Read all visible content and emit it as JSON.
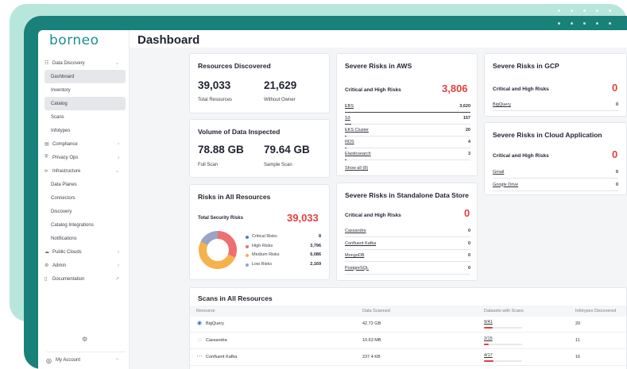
{
  "brand": {
    "logo": "borneo",
    "accent": "#1a8f88"
  },
  "page": {
    "title": "Dashboard"
  },
  "sidebar": {
    "items": [
      {
        "label": "Data Discovery",
        "icon": "grid-icon",
        "chevron": "⌄"
      },
      {
        "label": "Dashboard",
        "sub": true,
        "active": true
      },
      {
        "label": "Inventory",
        "sub": true
      },
      {
        "label": "Catalog",
        "sub": true,
        "active": true
      },
      {
        "label": "Scans",
        "sub": true
      },
      {
        "label": "Infotypes",
        "sub": true
      },
      {
        "label": "Compliance",
        "icon": "clipboard-icon",
        "chevron": "›"
      },
      {
        "label": "Privacy Ops",
        "icon": "shield-icon",
        "chevron": "›"
      },
      {
        "label": "Infrastructure",
        "icon": "infrastructure-icon",
        "chevron": "⌄"
      },
      {
        "label": "Data Planes",
        "sub": true
      },
      {
        "label": "Connectors",
        "sub": true
      },
      {
        "label": "Discovery",
        "sub": true
      },
      {
        "label": "Catalog Integrations",
        "sub": true
      },
      {
        "label": "Notifications",
        "sub": true
      },
      {
        "label": "Public Clouds",
        "icon": "cloud-icon",
        "chevron": "›"
      },
      {
        "label": "Admin",
        "icon": "gear-icon",
        "chevron": "›"
      },
      {
        "label": "Documentation",
        "icon": "book-icon",
        "chevron": "↗"
      }
    ],
    "account": "My Account"
  },
  "resources": {
    "title": "Resources Discovered",
    "total_value": "39,033",
    "total_label": "Total Resources",
    "owner_value": "21,629",
    "owner_label": "Without Owner"
  },
  "volume": {
    "title": "Volume of Data Inspected",
    "full_value": "78.88 GB",
    "full_label": "Full Scan",
    "sample_value": "79.64 GB",
    "sample_label": "Sample Scan"
  },
  "risks_all": {
    "title": "Risks in All Resources",
    "total_label": "Total Security Risks",
    "total_value": "39,033",
    "legend": [
      {
        "label": "Critical Risks",
        "value": "8",
        "color": "#4a7fd6",
        "share": 0.0002
      },
      {
        "label": "High Risks",
        "value": "3,796",
        "color": "#ee6f6f",
        "share": 0.315
      },
      {
        "label": "Medium Risks",
        "value": "6,086",
        "color": "#f6b24a",
        "share": 0.505
      },
      {
        "label": "Low Risks",
        "value": "2,169",
        "color": "#9aa4c6",
        "share": 0.18
      }
    ]
  },
  "aws": {
    "title": "Severe Risks in AWS",
    "risk_label": "Critical and High Risks",
    "risk_value": "3,806",
    "rows": [
      {
        "name": "EBS",
        "value": "3,620",
        "fill": 1.0
      },
      {
        "name": "S3",
        "value": "157",
        "fill": 0.05
      },
      {
        "name": "EKS Cluster",
        "value": "20",
        "fill": 0.01
      },
      {
        "name": "RDS",
        "value": "4",
        "fill": 0.005
      },
      {
        "name": "Elasticsearch",
        "value": "3",
        "fill": 0.004
      }
    ],
    "show_all": "Show all (8)"
  },
  "gcp": {
    "title": "Severe Risks in GCP",
    "risk_label": "Critical and High Risks",
    "risk_value": "0",
    "rows": [
      {
        "name": "BigQuery",
        "value": "0"
      }
    ]
  },
  "cloud_app": {
    "title": "Severe Risks in Cloud Application",
    "risk_label": "Critical and High Risks",
    "risk_value": "0",
    "rows": [
      {
        "name": "Gmail",
        "value": "0"
      },
      {
        "name": "Google Drive",
        "value": "0"
      }
    ]
  },
  "standalone": {
    "title": "Severe Risks in Standalone Data Store",
    "risk_label": "Critical and High Risks",
    "risk_value": "0",
    "rows": [
      {
        "name": "Cassandra",
        "value": "0"
      },
      {
        "name": "Confluent Kafka",
        "value": "0"
      },
      {
        "name": "MongoDB",
        "value": "0"
      },
      {
        "name": "PostgreSQL",
        "value": "0"
      }
    ]
  },
  "scans": {
    "title": "Scans in All Resources",
    "columns": [
      "Resource",
      "Data Scanned",
      "Datasets with Scans",
      "Infotypes Discovered"
    ],
    "rows": [
      {
        "resource": "BigQuery",
        "icon": "bigquery-icon",
        "scanned": "42.72 GB",
        "datasets": "9/41",
        "ratio": 0.22,
        "infotypes": "20"
      },
      {
        "resource": "Cassandra",
        "icon": "cassandra-icon",
        "scanned": "10.63 MB",
        "datasets": "2/15",
        "ratio": 0.13,
        "infotypes": "11"
      },
      {
        "resource": "Confluent Kafka",
        "icon": "kafka-icon",
        "scanned": "237.4 KB",
        "datasets": "4/17",
        "ratio": 0.24,
        "infotypes": "16"
      }
    ]
  }
}
